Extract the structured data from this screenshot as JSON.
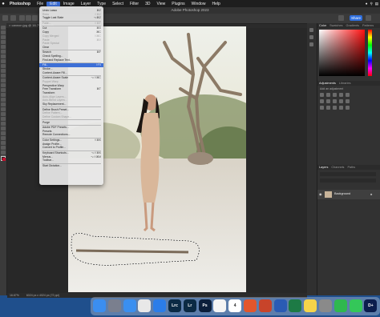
{
  "menubar": {
    "app": "Photoshop",
    "items": [
      "File",
      "Edit",
      "Image",
      "Layer",
      "Type",
      "Select",
      "Filter",
      "3D",
      "View",
      "Plugins",
      "Window",
      "Help"
    ],
    "active_index": 1
  },
  "window": {
    "title": "Adobe Photoshop 2023"
  },
  "document": {
    "tab": "× cannon.jpg @ 16.7% (RGB/8)",
    "zoom_status": "16.67%",
    "status_info": "6024 px x 4024 px (72 ppi)"
  },
  "optbar": {
    "share": "Share"
  },
  "edit_menu": {
    "items": [
      {
        "label": "Undo Lasso",
        "shortcut": "⌘Z",
        "disabled": false
      },
      {
        "label": "Redo",
        "shortcut": "⇧⌘Z",
        "disabled": true
      },
      {
        "label": "Toggle Last State",
        "shortcut": "⌥⌘Z",
        "disabled": false
      },
      {
        "sep": true
      },
      {
        "label": "Fade...",
        "shortcut": "⇧⌘F",
        "disabled": true
      },
      {
        "sep": true
      },
      {
        "label": "Cut",
        "shortcut": "⌘X",
        "disabled": false
      },
      {
        "label": "Copy",
        "shortcut": "⌘C",
        "disabled": false
      },
      {
        "label": "Copy Merged",
        "shortcut": "⇧⌘C",
        "disabled": true
      },
      {
        "label": "Paste",
        "shortcut": "⌘V",
        "disabled": true
      },
      {
        "label": "Paste Special",
        "shortcut": "",
        "disabled": true
      },
      {
        "label": "Clear",
        "shortcut": "",
        "disabled": false
      },
      {
        "sep": true
      },
      {
        "label": "Search",
        "shortcut": "⌘F",
        "disabled": false
      },
      {
        "label": "Check Spelling...",
        "shortcut": "",
        "disabled": false
      },
      {
        "label": "Find and Replace Text...",
        "shortcut": "",
        "disabled": false
      },
      {
        "sep": true
      },
      {
        "label": "Fill...",
        "shortcut": "⇧F5",
        "disabled": false,
        "highlight": true
      },
      {
        "label": "Stroke...",
        "shortcut": "",
        "disabled": false
      },
      {
        "label": "Content-Aware Fill...",
        "shortcut": "",
        "disabled": false
      },
      {
        "sep": true
      },
      {
        "label": "Content-Aware Scale",
        "shortcut": "⌥⇧⌘C",
        "disabled": false
      },
      {
        "label": "Puppet Warp",
        "shortcut": "",
        "disabled": true
      },
      {
        "label": "Perspective Warp",
        "shortcut": "",
        "disabled": false
      },
      {
        "label": "Free Transform",
        "shortcut": "⌘T",
        "disabled": false
      },
      {
        "label": "Transform",
        "shortcut": "",
        "disabled": false
      },
      {
        "label": "Auto-Align Layers...",
        "shortcut": "",
        "disabled": true
      },
      {
        "label": "Auto-Blend Layers...",
        "shortcut": "",
        "disabled": true
      },
      {
        "label": "Sky Replacement...",
        "shortcut": "",
        "disabled": false
      },
      {
        "sep": true
      },
      {
        "label": "Define Brush Preset...",
        "shortcut": "",
        "disabled": false
      },
      {
        "label": "Define Pattern...",
        "shortcut": "",
        "disabled": true
      },
      {
        "label": "Define Custom Shape...",
        "shortcut": "",
        "disabled": true
      },
      {
        "sep": true
      },
      {
        "label": "Purge",
        "shortcut": "",
        "disabled": false
      },
      {
        "sep": true
      },
      {
        "label": "Adobe PDF Presets...",
        "shortcut": "",
        "disabled": false
      },
      {
        "label": "Presets",
        "shortcut": "",
        "disabled": false
      },
      {
        "label": "Remote Connections...",
        "shortcut": "",
        "disabled": false
      },
      {
        "sep": true
      },
      {
        "label": "Color Settings...",
        "shortcut": "⇧⌘K",
        "disabled": false
      },
      {
        "label": "Assign Profile...",
        "shortcut": "",
        "disabled": false
      },
      {
        "label": "Convert to Profile...",
        "shortcut": "",
        "disabled": false
      },
      {
        "sep": true
      },
      {
        "label": "Keyboard Shortcuts...",
        "shortcut": "⌥⇧⌘K",
        "disabled": false
      },
      {
        "label": "Menus...",
        "shortcut": "⌥⇧⌘M",
        "disabled": false
      },
      {
        "label": "Toolbar...",
        "shortcut": "",
        "disabled": false
      },
      {
        "sep": true
      },
      {
        "label": "Start Dictation...",
        "shortcut": "",
        "disabled": false
      }
    ]
  },
  "panels": {
    "color_tabs": [
      "Color",
      "Swatches",
      "Gradients",
      "Patterns"
    ],
    "adjust_tabs": [
      "Adjustments",
      "Libraries"
    ],
    "adjust_hint": "Add an adjustment",
    "layer_tabs": [
      "Layers",
      "Channels",
      "Paths"
    ],
    "layer_name": "Background",
    "fg_color": "#c4122f"
  },
  "dock": {
    "apps": [
      {
        "name": "finder-icon",
        "label": "",
        "color": "#3b8ef0"
      },
      {
        "name": "launchpad-icon",
        "label": "",
        "color": "#7a7f8e"
      },
      {
        "name": "mail-icon",
        "label": "",
        "color": "#3a8ff0"
      },
      {
        "name": "chrome-icon",
        "label": "",
        "color": "#e8e8e8"
      },
      {
        "name": "safari-icon",
        "label": "",
        "color": "#2b7de9"
      },
      {
        "name": "lightroom-classic-icon",
        "label": "Lrc",
        "color": "#0b2a44"
      },
      {
        "name": "lightroom-icon",
        "label": "Lr",
        "color": "#0b2a44"
      },
      {
        "name": "photoshop-icon",
        "label": "Ps",
        "color": "#0b1e3a"
      },
      {
        "name": "photos-icon",
        "label": "",
        "color": "#f4f4f4"
      },
      {
        "name": "calendar-icon",
        "label": "4",
        "color": "#ffffff"
      },
      {
        "name": "office-icon",
        "label": "",
        "color": "#e2562c"
      },
      {
        "name": "powerpoint-icon",
        "label": "",
        "color": "#c8442a"
      },
      {
        "name": "word-icon",
        "label": "",
        "color": "#2a5bb4"
      },
      {
        "name": "excel-icon",
        "label": "",
        "color": "#1d7a45"
      },
      {
        "name": "notes-icon",
        "label": "",
        "color": "#f6d44a"
      },
      {
        "name": "settings-icon",
        "label": "",
        "color": "#8a8a8a"
      },
      {
        "name": "facetime-icon",
        "label": "",
        "color": "#2fb84f"
      },
      {
        "name": "messages-icon",
        "label": "",
        "color": "#34c759"
      },
      {
        "name": "disney-plus-icon",
        "label": "D+",
        "color": "#0b1d4e"
      }
    ]
  }
}
